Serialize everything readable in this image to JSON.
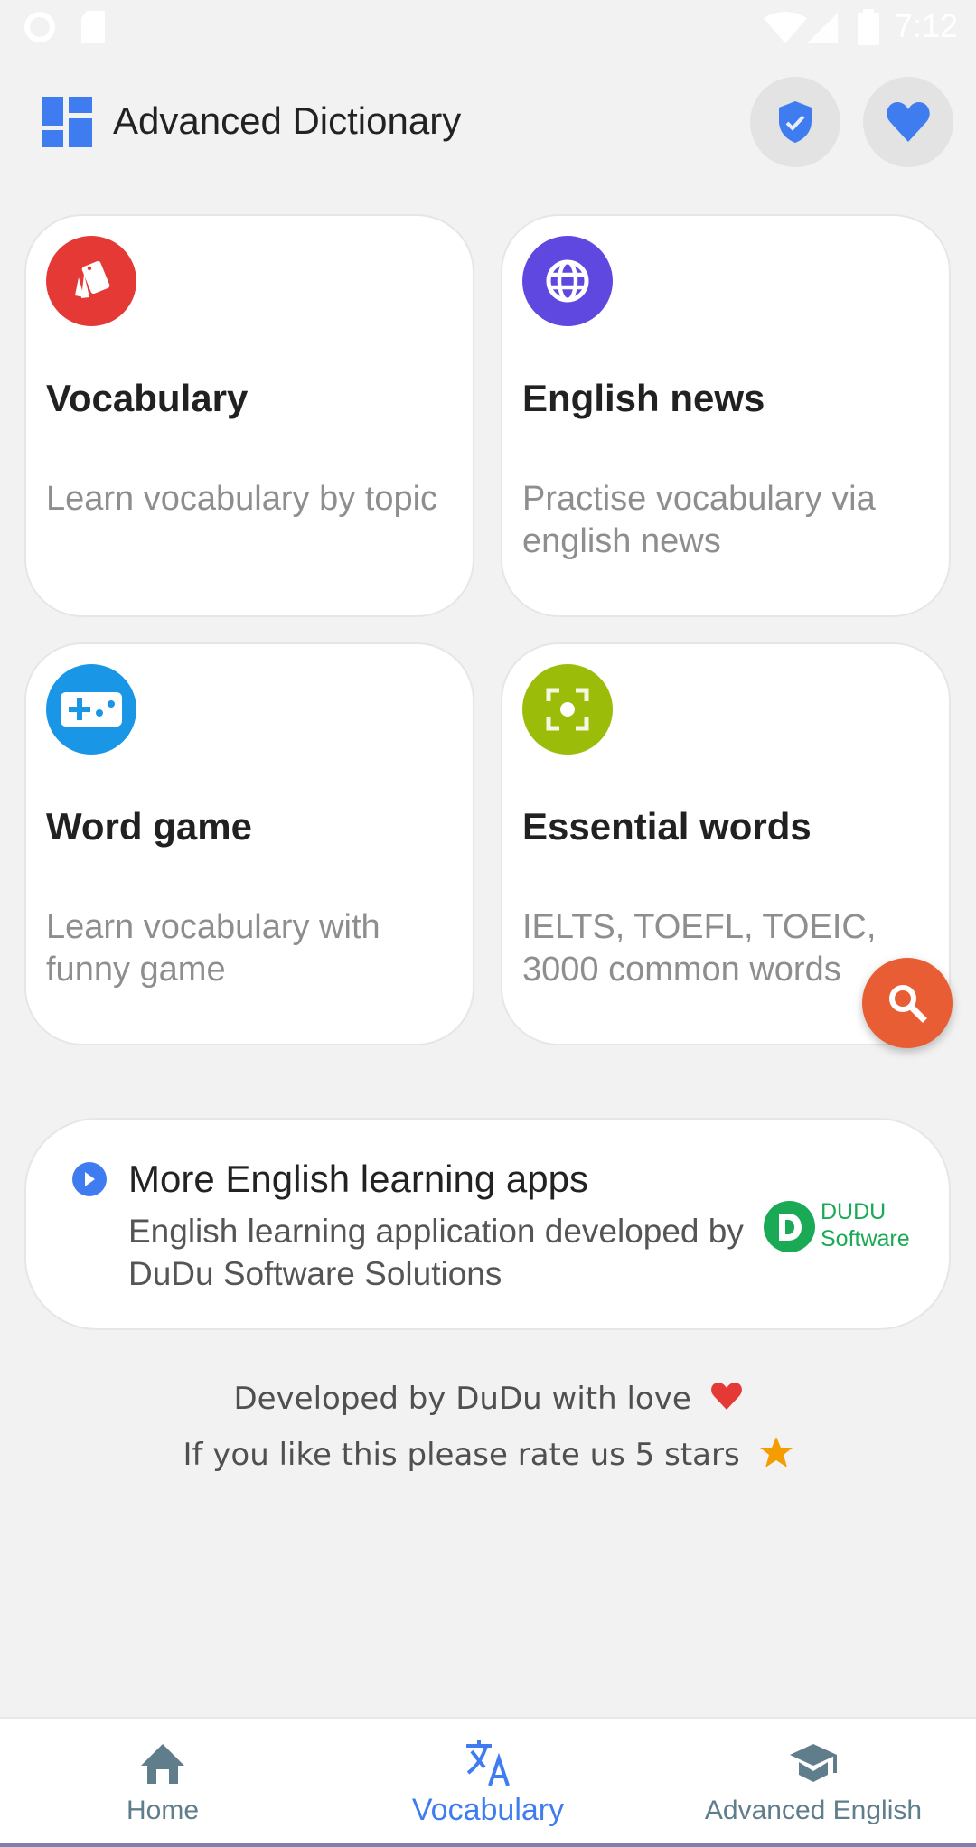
{
  "status_bar": {
    "time": "7:12",
    "left_icons": [
      "circle-notification-icon",
      "sd-card-icon"
    ],
    "right_icons": [
      "wifi-icon",
      "signal-icon",
      "battery-icon"
    ]
  },
  "app_bar": {
    "title": "Advanced Dictionary",
    "logo_icon": "dashboard-grid-icon",
    "actions": [
      {
        "name": "privacy",
        "icon": "shield-check-icon"
      },
      {
        "name": "favorites",
        "icon": "heart-icon"
      }
    ],
    "accent": "#3f7cf0"
  },
  "cards": [
    {
      "title": "Vocabulary",
      "subtitle": "Learn vocabulary by topic",
      "icon": "flashcards-icon",
      "color": "#e53935"
    },
    {
      "title": "English news",
      "subtitle": "Practise vocabulary via english news",
      "icon": "globe-icon",
      "color": "#5e48e0"
    },
    {
      "title": "Word game",
      "subtitle": "Learn vocabulary with funny game",
      "icon": "gamepad-icon",
      "color": "#1a96e6"
    },
    {
      "title": "Essential words",
      "subtitle": "IELTS, TOEFL, TOEIC, 3000 common words",
      "icon": "focus-center-icon",
      "color": "#9bbd0a"
    }
  ],
  "fab": {
    "icon": "search-icon",
    "color": "#e85d33"
  },
  "promo": {
    "title": "More English learning apps",
    "subtitle": "English learning application developed by DuDu Software Solutions",
    "icon": "play-circle-icon",
    "logo_line1": "DUDU",
    "logo_line2": "Software",
    "logo_letter": "D",
    "logo_color": "#1aaa55"
  },
  "footer": {
    "line1": "Developed by DuDu with love",
    "line1_emoji": "❤",
    "line2": "If you like this please rate us 5 stars",
    "line2_emoji": "★"
  },
  "bottom_nav": {
    "items": [
      {
        "label": "Home",
        "icon": "home-icon",
        "active": false
      },
      {
        "label": "Vocabulary",
        "icon": "translate-icon",
        "active": true
      },
      {
        "label": "Advanced English",
        "icon": "graduation-cap-icon",
        "active": false
      }
    ],
    "active_color": "#3f7cf0",
    "inactive_color": "#607d8b"
  }
}
